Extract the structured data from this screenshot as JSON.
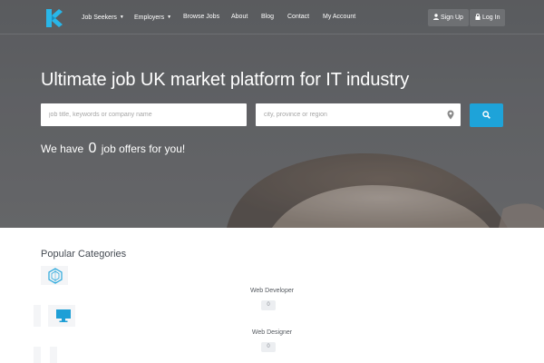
{
  "nav": {
    "items": [
      {
        "label": "Job Seekers",
        "dropdown": true
      },
      {
        "label": "Employers",
        "dropdown": true
      },
      {
        "label": "Browse Jobs"
      },
      {
        "label": "About"
      },
      {
        "label": "Blog"
      },
      {
        "label": "Contact"
      },
      {
        "label": "My Account"
      }
    ],
    "sign_up_label": "Sign Up",
    "log_in_label": "Log In"
  },
  "hero": {
    "title": "Ultimate job UK market platform for IT industry",
    "keywords_placeholder": "job title, keywords or company name",
    "location_placeholder": "city, province or region",
    "offers_prefix": "We have",
    "offers_count": "0",
    "offers_suffix": "job offers for you!"
  },
  "categories": {
    "title": "Popular Categories",
    "items": [
      {
        "label": "Web Developer",
        "count": "0",
        "icon": "hexagon-code-icon"
      },
      {
        "label": "Web Designer",
        "count": "0",
        "icon": "monitor-icon"
      }
    ]
  },
  "colors": {
    "accent": "#1ea3d9",
    "hero_overlay": "#5f6164",
    "logo": "#29b6e8"
  }
}
